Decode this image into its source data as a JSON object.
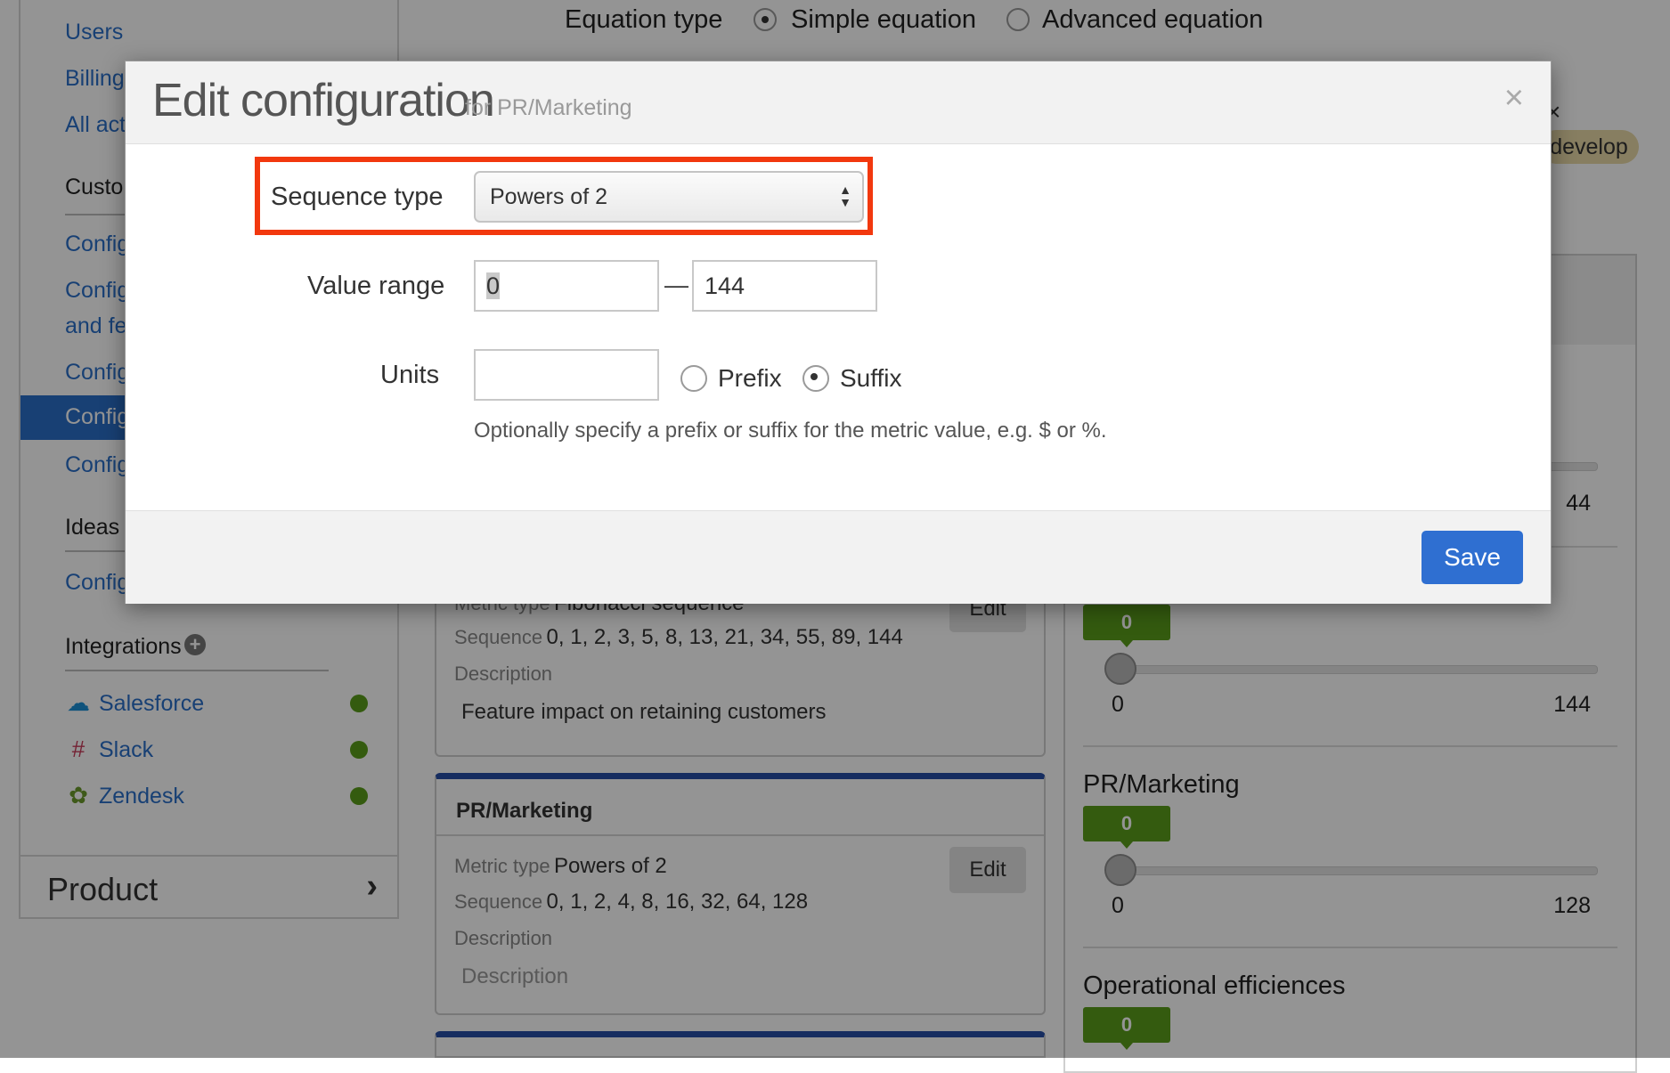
{
  "equation": {
    "label": "Equation type",
    "options": [
      "Simple equation",
      "Advanced equation"
    ],
    "selected": "Simple equation"
  },
  "sidebar": {
    "links_top": [
      "Users",
      "Billing",
      "All act"
    ],
    "customize_heading": "Custo",
    "config_links": [
      "Config",
      "Config",
      "and fe",
      "Config",
      "Config",
      "Config"
    ],
    "active_item": "Config",
    "ideas_heading": "Ideas",
    "ideas_link": "Config",
    "integrations_heading": "Integrations",
    "integrations": [
      {
        "name": "Salesforce",
        "icon": "cloud-icon",
        "status_color": "#5a9e1b"
      },
      {
        "name": "Slack",
        "icon": "slack-icon",
        "status_color": "#5a9e1b"
      },
      {
        "name": "Zendesk",
        "icon": "zendesk-icon",
        "status_color": "#5a9e1b"
      }
    ],
    "product_label": "Product"
  },
  "background_tag": "develop",
  "cards": {
    "partial": {
      "metric_label": "Metric type",
      "metric_value": "Fibonacci sequence",
      "sequence_label": "Sequence",
      "sequence_value": "0, 1, 2, 3, 5, 8, 13, 21, 34, 55, 89, 144",
      "description_label": "Description",
      "description_value": "Feature impact on retaining customers",
      "edit_label": "Edit"
    },
    "pr_marketing": {
      "title": "PR/Marketing",
      "metric_label": "Metric type",
      "metric_value": "Powers of 2",
      "sequence_label": "Sequence",
      "sequence_value": "0, 1, 2, 4, 8, 16, 32, 64, 128",
      "description_label": "Description",
      "description_value": "Description",
      "edit_label": "Edit"
    }
  },
  "right_panel": {
    "top_max": "44",
    "sliders": [
      {
        "name": "",
        "value": "0",
        "min": "0",
        "max": "144"
      },
      {
        "name": "PR/Marketing",
        "value": "0",
        "min": "0",
        "max": "128"
      },
      {
        "name": "Operational efficiences",
        "value": "0"
      }
    ]
  },
  "modal": {
    "title": "Edit configuration",
    "subtitle": "for PR/Marketing",
    "close_symbol": "×",
    "sequence_type_label": "Sequence type",
    "sequence_type_value": "Powers of 2",
    "value_range_label": "Value range",
    "range_min": "0",
    "range_separator": "—",
    "range_max": "144",
    "units_label": "Units",
    "units_value": "",
    "unit_position_options": [
      "Prefix",
      "Suffix"
    ],
    "unit_position_selected": "Suffix",
    "help_text": "Optionally specify a prefix or suffix for the metric value, e.g. $ or %.",
    "save_label": "Save",
    "highlight_color": "#f2380e"
  },
  "colors": {
    "accent": "#2a6fc9",
    "save_button": "#2f6fd1",
    "badge_green": "#5a9e1b",
    "card_top_blue": "#274fa5"
  }
}
